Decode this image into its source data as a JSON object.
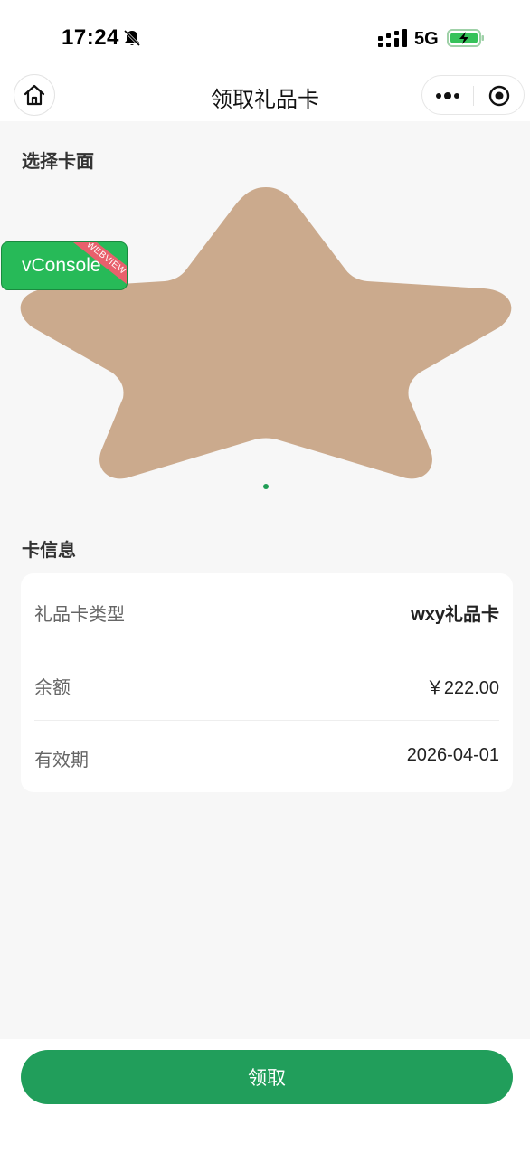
{
  "status_bar": {
    "time": "17:24",
    "network": "5G",
    "icons": [
      "bell-muted-icon",
      "signal-icon",
      "battery-charging-icon"
    ]
  },
  "nav": {
    "title": "领取礼品卡",
    "icons": [
      "home-icon",
      "more-icon",
      "target-close-icon"
    ]
  },
  "sections": {
    "card_face_title": "选择卡面",
    "card_info_title": "卡信息"
  },
  "card_face": {
    "shape": "star",
    "color": "#cbaa8d",
    "indicator_color": "#1f9d55"
  },
  "vconsole": {
    "label": "vConsole",
    "ribbon": "WEBVIEW"
  },
  "card_info": {
    "rows": [
      {
        "label": "礼品卡类型",
        "value": "wxy礼品卡"
      },
      {
        "label": "余额",
        "value": "￥222.00"
      },
      {
        "label": "有效期",
        "value": "2026-04-01"
      }
    ]
  },
  "action": {
    "claim_label": "领取",
    "accent": "#219e5b"
  }
}
